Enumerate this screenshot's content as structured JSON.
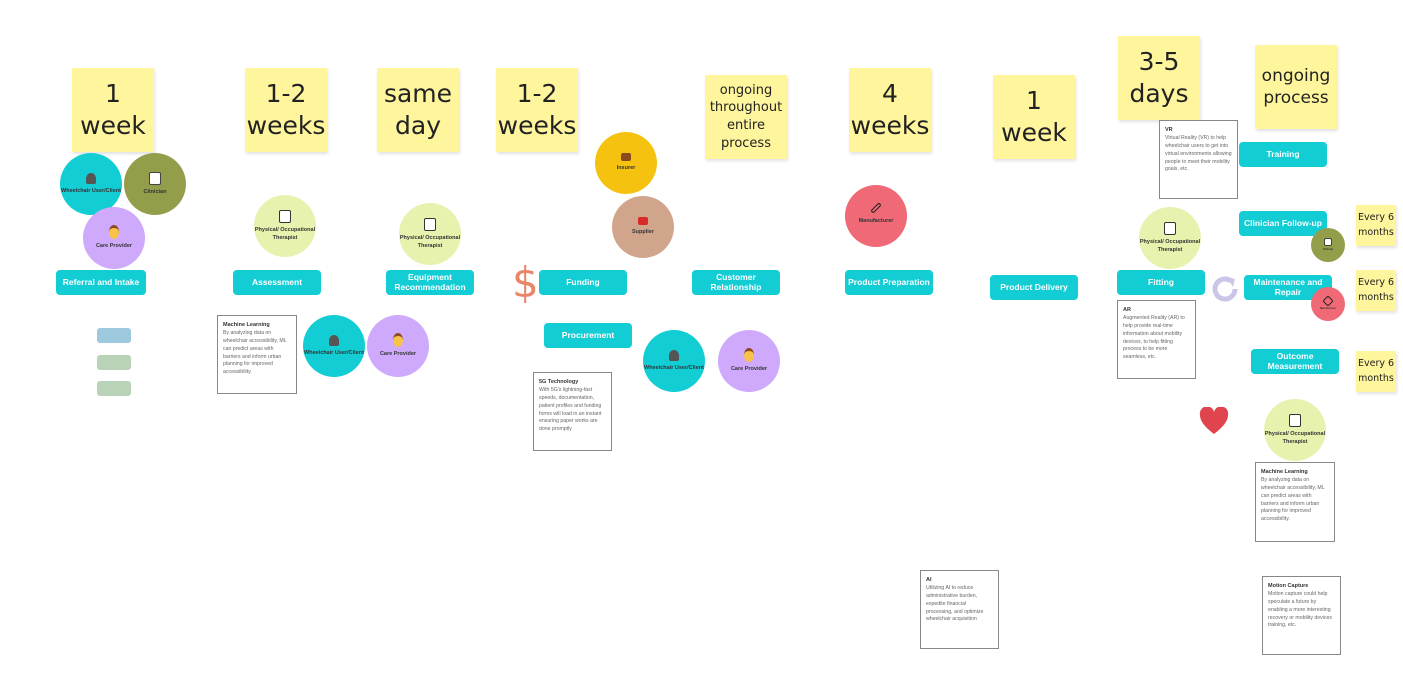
{
  "durations": [
    "1 week",
    "1-2 weeks",
    "same day",
    "1-2 weeks",
    "ongoing throughout entire process",
    "4 weeks",
    "1 week",
    "3-5 days",
    "ongoing process"
  ],
  "frequencies": [
    "Every 6 months",
    "Every 6 months",
    "Every 6 months"
  ],
  "stages": {
    "referral": "Referral and Intake",
    "assessment": "Assessment",
    "equipment": "Equipment Recommendation",
    "funding": "Funding",
    "customer": "Customer Relationship",
    "preparation": "Product Preparation",
    "delivery": "Product Delivery",
    "fitting": "Fitting",
    "procurement": "Procurement",
    "training": "Training",
    "followup": "Clinician Follow-up",
    "maintenance": "Maintenance and Repair",
    "outcome": "Outcome Measurement"
  },
  "actors": {
    "wheelchair": "Wheelchair User/Client",
    "clinician": "Clinician",
    "care": "Care Provider",
    "therapist": "Physical/ Occupational Therapist",
    "insurer": "Insurer",
    "supplier": "Supplier",
    "manufacturer": "Manufacturer"
  },
  "notes": [
    {
      "title": "Machine Learning",
      "body": "By analyzing data on wheelchair accessibility, ML can predict areas with barriers and inform urban planning for improved accessibility."
    },
    {
      "title": "5G Technology",
      "body": "With 5G's lightning-fast speeds, documentation, patient profiles and funding forms will load in an instant ensuring paper works are done promptly"
    },
    {
      "title": "VR",
      "body": "Virtual Reality (VR) to help wheelchair users to get into virtual environments allowing people to meet their mobility goals, etc."
    },
    {
      "title": "AR",
      "body": "Augmented Reality (AR) to help provide real-time information about mobility devices, to help fitting process to be more seamless, etc."
    },
    {
      "title": "Machine Learning",
      "body": "By analyzing data on wheelchair accessibility, ML can predict areas with barriers and inform urban planning for improved accessibility."
    },
    {
      "title": "AI",
      "body": "Utilizing AI to reduce administrative burden, expedite financial processing, and optimize wheelchair acquisition"
    },
    {
      "title": "Motion Capture",
      "body": "Motion capture could help speculate a future by enabling a more interesting recovery or mobility devices training, etc."
    }
  ],
  "symbols": {
    "dollar": "$"
  },
  "colors": {
    "stage": "#12cdd4",
    "sticky": "#fef59d"
  }
}
